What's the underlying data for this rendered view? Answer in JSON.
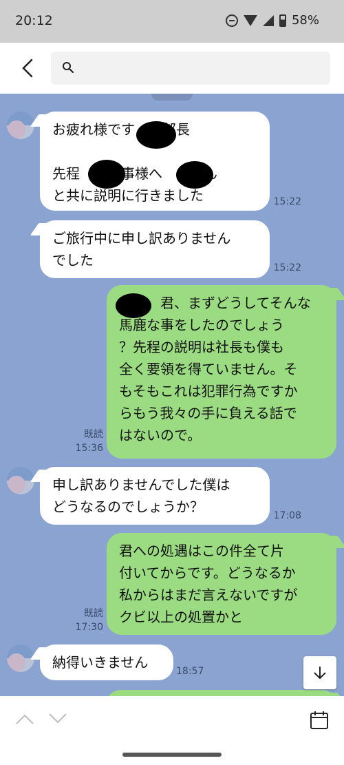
{
  "status_bar": {
    "time": "20:12",
    "battery": "58%",
    "icons": [
      "do-not-disturb-icon",
      "wifi-icon",
      "signal-icon",
      "battery-icon"
    ]
  },
  "header": {
    "back_icon": "chevron-left-icon",
    "search_icon": "search-icon",
    "search_value": ""
  },
  "messages": [
    {
      "side": "in",
      "text": "お疲れ様です　　部長\n\n先程　　商事様へ　　さん\nと共に説明に行きました",
      "time": "15:22"
    },
    {
      "side": "in",
      "text": "ご旅行中に申し訳ありません\nでした",
      "time": "15:22"
    },
    {
      "side": "out",
      "text": "　　　君、まずどうしてそんな\n馬鹿な事をしたのでしょう\n？先程の説明は社長も僕も\n全く要領を得ていません。そ\nもそもこれは犯罪行為ですか\nらもう我々の手に負える話で\nはないので。",
      "read": "既読",
      "time": "15:36"
    },
    {
      "side": "in",
      "text": "申し訳ありませんでした僕は\nどうなるのでしょうか？",
      "time": "17:08"
    },
    {
      "side": "out",
      "text": "君への処遇はこの件全て片\n付いてからです。どうなるか\n私からはまだ言えないですが\nクビ以上の処置かと",
      "read": "既読",
      "time": "17:30"
    },
    {
      "side": "in",
      "text": "納得いきません",
      "time": "18:57"
    }
  ],
  "colors": {
    "chat_bg": "#8aa3d0",
    "incoming": "#ffffff",
    "outgoing": "#9bdc82",
    "status_bar": "#cfcfcf"
  },
  "bottom_bar": {
    "icons": [
      "chevron-up-icon",
      "chevron-down-icon",
      "calendar-icon"
    ]
  },
  "floating": {
    "icon": "arrow-down-icon"
  }
}
